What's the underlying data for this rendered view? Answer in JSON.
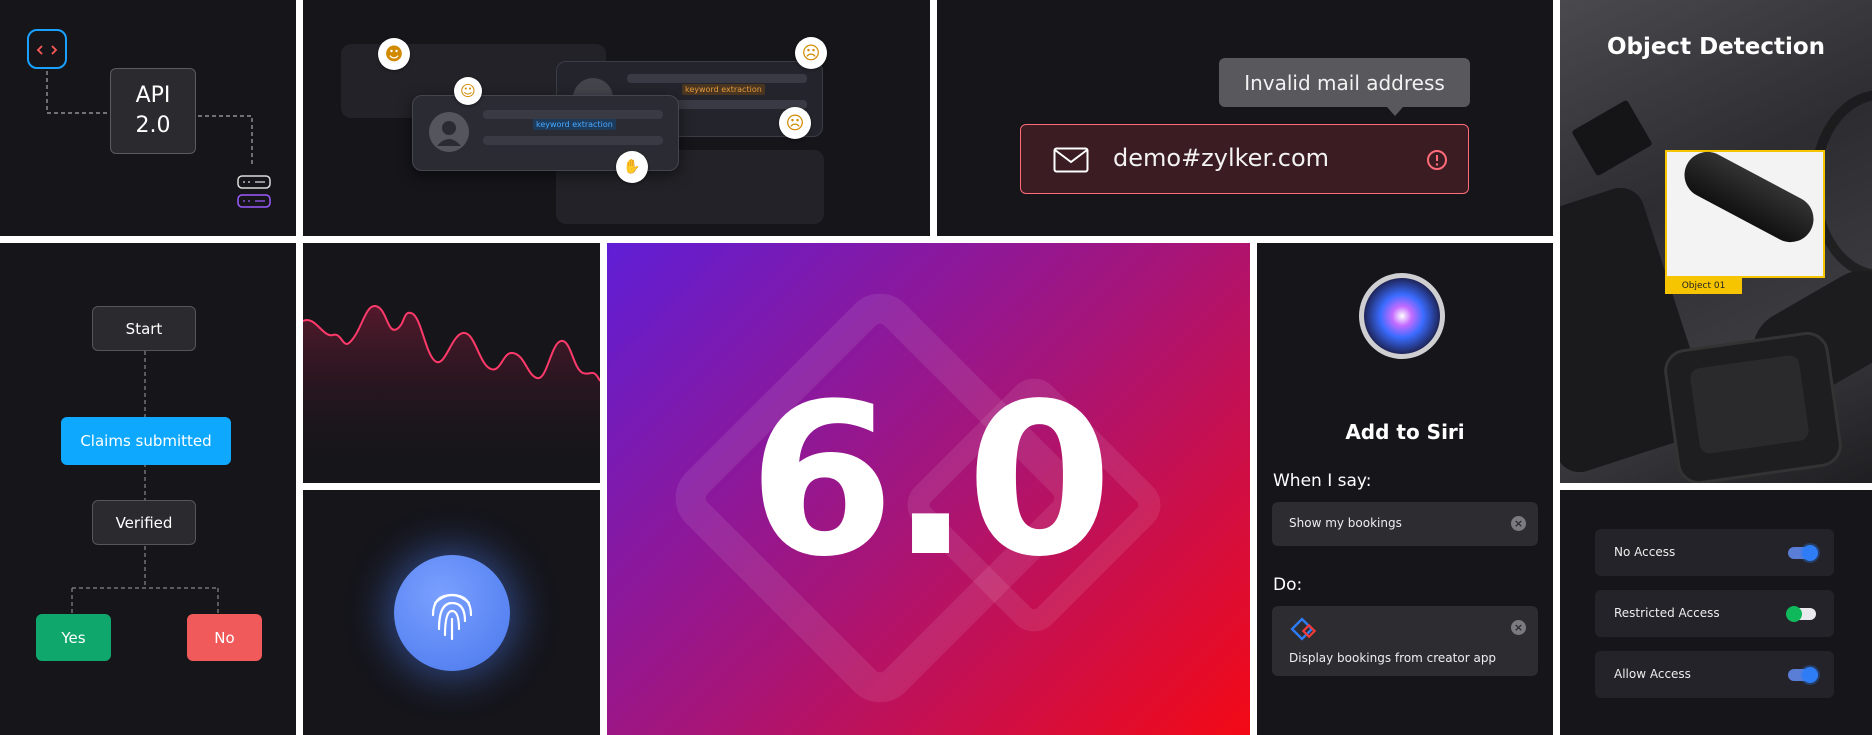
{
  "api": {
    "title_line1": "API",
    "title_line2": "2.0"
  },
  "sentiment": {
    "keyword_top": "keyword extraction",
    "keyword_bottom": "keyword extraction"
  },
  "email": {
    "tooltip": "Invalid mail address",
    "value": "demo#zylker.com"
  },
  "object_detection": {
    "title": "Object Detection",
    "label": "Object 01"
  },
  "flowchart": {
    "start": "Start",
    "claims": "Claims submitted",
    "verified": "Verified",
    "yes": "Yes",
    "no": "No"
  },
  "hero": {
    "version": "6.0"
  },
  "siri": {
    "title": "Add to Siri",
    "when_label": "When I say:",
    "phrase": "Show my bookings",
    "do_label": "Do:",
    "action": "Display bookings from creator app"
  },
  "access": {
    "items": [
      {
        "label": "No Access"
      },
      {
        "label": "Restricted Access"
      },
      {
        "label": "Allow Access"
      }
    ]
  },
  "colors": {
    "accent_blue": "#0fa8ff",
    "yes_green": "#10a76c",
    "no_red": "#f05a5a",
    "error_red": "#ff6b78",
    "detect_yellow": "#f7c400"
  }
}
